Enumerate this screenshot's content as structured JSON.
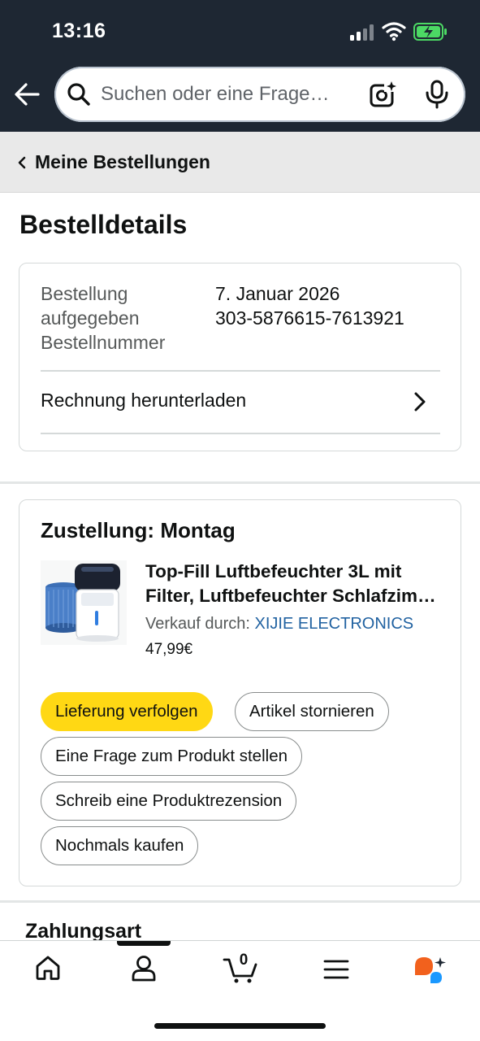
{
  "status_bar": {
    "time": "13:16"
  },
  "search": {
    "placeholder": "Suchen oder eine Frage…"
  },
  "breadcrumb": {
    "label": "Meine Bestellungen"
  },
  "page": {
    "title": "Bestelldetails"
  },
  "order": {
    "placed_label": "Bestellung aufgegeben",
    "placed_date": "7. Januar 2026",
    "number_label": "Bestellnummer",
    "number": "303-5876615-7613921",
    "invoice_label": "Rechnung herunterladen"
  },
  "delivery": {
    "title": "Zustellung: Montag",
    "product": {
      "title_line1": "Top-Fill Luftbefeuchter 3L mit",
      "title_line2": "Filter, Luftbefeuchter Schlafzimmer",
      "seller_prefix": "Verkauf durch:",
      "seller_name": "XIJIE ELECTRONICS",
      "price": "47,99€"
    },
    "actions": {
      "track": "Lieferung verfolgen",
      "cancel": "Artikel stornieren",
      "question": "Eine Frage zum Produkt stellen",
      "review": "Schreib eine Produktrezension",
      "buy_again": "Nochmals kaufen"
    }
  },
  "payment": {
    "title": "Zahlungsart"
  },
  "bottom_nav": {
    "cart_count": "0",
    "items": [
      "home-icon",
      "account-icon",
      "cart-icon",
      "menu-icon",
      "rufus-assistant-icon"
    ]
  },
  "colors": {
    "header_bg": "#1e2733",
    "primary_button": "#ffd814",
    "link": "#2162a1",
    "battery_charging": "#4cd964"
  }
}
